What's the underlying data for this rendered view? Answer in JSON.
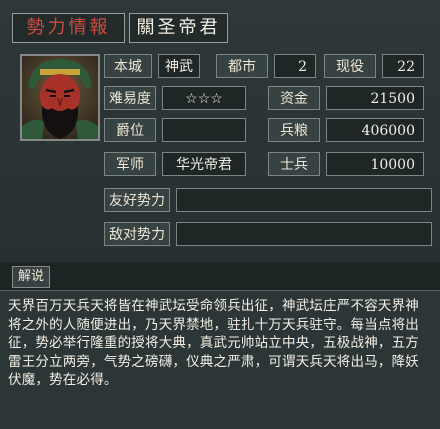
{
  "header": {
    "faction_label": "勢力情報",
    "ruler_name": "關圣帝君"
  },
  "stats": {
    "base_city_label": "本城",
    "base_city_value": "神武",
    "cities_label": "都市",
    "cities_value": "2",
    "officers_label": "现役",
    "officers_value": "22",
    "difficulty_label": "难易度",
    "difficulty_value": "☆☆☆",
    "funds_label": "资金",
    "funds_value": "21500",
    "rank_label": "爵位",
    "rank_value": "",
    "food_label": "兵粮",
    "food_value": "406000",
    "strategist_label": "军师",
    "strategist_value": "华光帝君",
    "soldiers_label": "士兵",
    "soldiers_value": "10000",
    "allies_label": "友好势力",
    "allies_value": "",
    "enemies_label": "敌对势力",
    "enemies_value": ""
  },
  "description": {
    "tab_label": "解说",
    "text": "天界百万天兵天将皆在神武坛受命领兵出征，神武坛庄严不容天界神将之外的人随便进出，乃天界禁地，驻扎十万天兵驻守。每当点将出征，势必举行隆重的授将大典，真武元帅站立中央，五极战神，五方雷王分立两旁，气势之磅礴，仪典之严肃，可谓天兵天将出马，降妖伏魔，势在必得。"
  },
  "colors": {
    "faction_tag": "#d14a3c",
    "panel_bg": "#2e3838",
    "value_bg": "#1e2626"
  }
}
